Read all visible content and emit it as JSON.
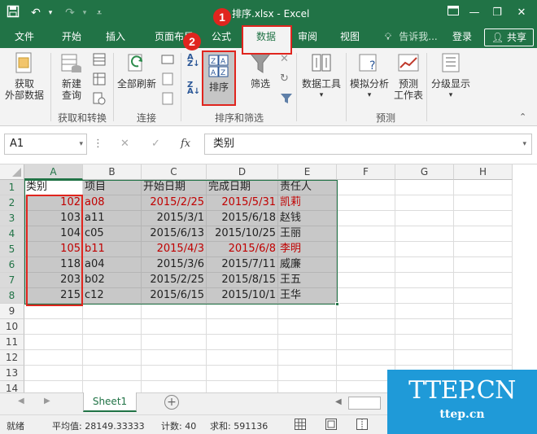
{
  "window": {
    "title": "排序.xlsx - Excel"
  },
  "tabs": [
    {
      "label": "文件"
    },
    {
      "label": "开始"
    },
    {
      "label": "插入"
    },
    {
      "label": "页面布局"
    },
    {
      "label": "公式"
    },
    {
      "label": "数据"
    },
    {
      "label": "审阅"
    },
    {
      "label": "视图"
    }
  ],
  "tell_me": "告诉我...",
  "login": "登录",
  "share": "共享",
  "ribbon": {
    "get_data": {
      "line1": "获取",
      "line2": "外部数据"
    },
    "new_query": {
      "line1": "新建",
      "line2": "查询"
    },
    "refresh_all": "全部刷新",
    "sort": "排序",
    "filter": "筛选",
    "data_tools": "数据工具",
    "what_if": "模拟分析",
    "forecast_sheet": {
      "line1": "预测",
      "line2": "工作表"
    },
    "outline": "分级显示",
    "groups": {
      "get_transform": "获取和转换",
      "connections": "连接",
      "sort_filter": "排序和筛选",
      "forecast": "预测"
    }
  },
  "formula_bar": {
    "name_box": "A1",
    "fx": "fx",
    "value": "类别"
  },
  "columns": [
    "A",
    "B",
    "C",
    "D",
    "E",
    "F",
    "G",
    "H"
  ],
  "rows": [
    "1",
    "2",
    "3",
    "4",
    "5",
    "6",
    "7",
    "8",
    "9",
    "10",
    "11",
    "12",
    "13",
    "14"
  ],
  "table": {
    "header": [
      "类别",
      "项目",
      "开始日期",
      "完成日期",
      "责任人"
    ],
    "rows": [
      [
        "102",
        "a08",
        "2015/2/25",
        "2015/5/31",
        "凯莉"
      ],
      [
        "103",
        "a11",
        "2015/3/1",
        "2015/6/18",
        "赵钱"
      ],
      [
        "104",
        "c05",
        "2015/6/13",
        "2015/10/25",
        "王丽"
      ],
      [
        "105",
        "b11",
        "2015/4/3",
        "2015/6/8",
        "李明"
      ],
      [
        "118",
        "a04",
        "2015/3/6",
        "2015/7/11",
        "威廉"
      ],
      [
        "203",
        "b02",
        "2015/2/25",
        "2015/8/15",
        "王五"
      ],
      [
        "215",
        "c12",
        "2015/6/15",
        "2015/10/1",
        "王华"
      ]
    ]
  },
  "sheet_tab": "Sheet1",
  "status": {
    "ready": "就绪",
    "average": "平均值: 28149.33333",
    "count": "计数: 40",
    "sum": "求和: 591136"
  },
  "annotations": {
    "step1": "1",
    "step2": "2"
  },
  "watermark": {
    "big": "TTEP.CN",
    "small": "ttep.cn"
  },
  "colors": {
    "excel_green": "#217346",
    "annotation_red": "#e0251e",
    "red_text": "#c00000",
    "watermark_blue": "#1f9ad8"
  }
}
